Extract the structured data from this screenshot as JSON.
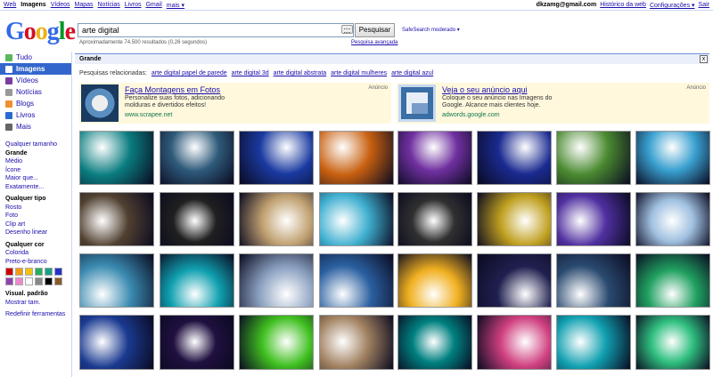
{
  "topbar": {
    "links": [
      "Web",
      "Imagens",
      "Vídeos",
      "Mapas",
      "Notícias",
      "Livros",
      "Gmail",
      "mais ▾"
    ],
    "selected_index": 1,
    "user_email": "dkzamg@gmail.com",
    "history_label": "Histórico da web",
    "settings_label": "Configurações ▾",
    "signout_label": "Sair"
  },
  "logo": {
    "letters": [
      "G",
      "o",
      "o",
      "g",
      "l",
      "e"
    ],
    "colors": [
      "#3369e8",
      "#d50f25",
      "#eeb211",
      "#3369e8",
      "#009925",
      "#d50f25"
    ]
  },
  "search": {
    "query": "arte digital",
    "button": "Pesquisar",
    "safesearch": "SafeSearch moderado ▾",
    "results": "Aproximadamente 74.500 resultados (0,26 segundos)",
    "advanced": "Pesquisa avançada"
  },
  "nav": [
    {
      "label": "Tudo",
      "icon": "all-icon",
      "color": "#5bb75b"
    },
    {
      "label": "Imagens",
      "icon": "images-icon",
      "color": "#ffffff",
      "selected": true
    },
    {
      "label": "Vídeos",
      "icon": "videos-icon",
      "color": "#7a3d9e"
    },
    {
      "label": "Notícias",
      "icon": "news-icon",
      "color": "#999999"
    },
    {
      "label": "Blogs",
      "icon": "blogs-icon",
      "color": "#f09030"
    },
    {
      "label": "Livros",
      "icon": "books-icon",
      "color": "#2a6ad0"
    },
    {
      "label": "Mais",
      "icon": "more-icon",
      "color": "#666666"
    }
  ],
  "filters": {
    "size": [
      "Qualquer tamanho",
      "Grande",
      "Médio",
      "Ícone",
      "Maior que...",
      "Exatamente..."
    ],
    "size_selected": 1,
    "type_heading": "Qualquer tipo",
    "type": [
      "Rosto",
      "Foto",
      "Clip art",
      "Desenho linear"
    ],
    "color_heading": "Qualquer cor",
    "color": [
      "Colorida",
      "Preto-e-branco"
    ],
    "swatches": [
      "#cc0000",
      "#f39c12",
      "#f1c40f",
      "#27ae60",
      "#16a085",
      "#2233cc",
      "#8e44ad",
      "#ee88cc",
      "#ffffff",
      "#888888",
      "#000000",
      "#8b5a2b"
    ],
    "view": "Visual. padrão",
    "show_size": "Mostrar tam.",
    "reset": "Redefinir ferramentas"
  },
  "band": {
    "title": "Grande",
    "close": "x"
  },
  "related": {
    "prefix": "Pesquisas relacionadas:",
    "items": [
      "arte digital papel de parede",
      "arte digital 3d",
      "arte digital abstrata",
      "arte digital mulheres",
      "arte digital azul"
    ]
  },
  "ads": [
    {
      "title": "Faça Montagens em Fotos",
      "desc": "Personalize suas fotos, adicionando molduras e divertidos efeitos!",
      "url": "www.scrapee.net",
      "tag": "Anúncio"
    },
    {
      "title": "Veja o seu anúncio aqui",
      "desc": "Coloque o seu anúncio nas Imagens do Google. Alcance mais clientes hoje.",
      "url": "adwords.google.com",
      "tag": "Anúncio"
    }
  ],
  "thumb_colors": [
    [
      "#0a7d80",
      "#2e5a7a",
      "#1a3aa0",
      "#c86010",
      "#7030a0",
      "#1a2a90",
      "#4a8a30",
      "#3aa0d0"
    ],
    [
      "#504030",
      "#202020",
      "#c0a070",
      "#40b0d0",
      "#303030",
      "#c0a020",
      "#5030a0",
      "#a0c0e0"
    ],
    [
      "#3a8ab0",
      "#10a0b0",
      "#8aa0c0",
      "#2a60a0",
      "#f0b020",
      "#202050",
      "#2a4a70",
      "#20a060"
    ],
    [
      "#1a3a90",
      "#201040",
      "#40c020",
      "#a08060",
      "#008080",
      "#d04080",
      "#10a0b0",
      "#30c080"
    ]
  ]
}
